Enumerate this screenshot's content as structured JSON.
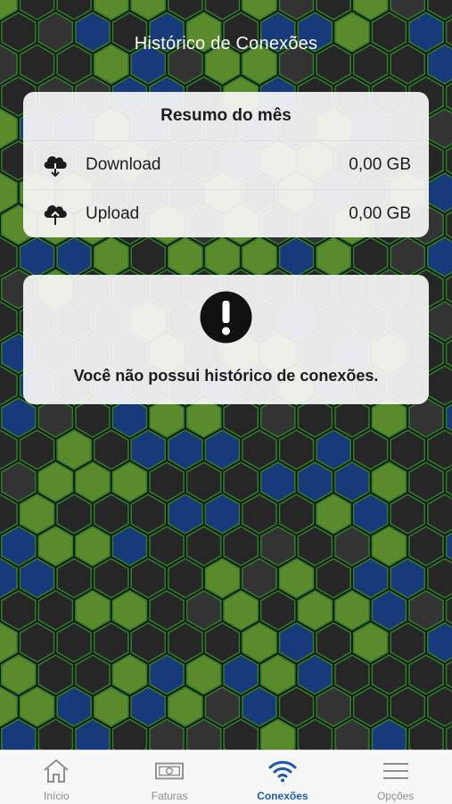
{
  "header": {
    "title": "Histórico de Conexões"
  },
  "summary": {
    "title": "Resumo do mês",
    "rows": [
      {
        "icon": "cloud-download-icon",
        "label": "Download",
        "value": "0,00 GB"
      },
      {
        "icon": "cloud-upload-icon",
        "label": "Upload",
        "value": "0,00 GB"
      }
    ]
  },
  "empty_state": {
    "icon": "exclamation-circle-icon",
    "message": "Você não possui histórico de conexões."
  },
  "colors": {
    "background": "#141414",
    "hex_green": "#5a8a2c",
    "hex_blue": "#163a7a",
    "hex_dark": "#262626",
    "hex_border": "#2f7a2a",
    "tab_active": "#1f5aa8",
    "tab_inactive": "#8e8e8e"
  },
  "tabbar": {
    "tabs": [
      {
        "icon": "house-icon",
        "label": "Início",
        "active": false
      },
      {
        "icon": "banknote-icon",
        "label": "Faturas",
        "active": false
      },
      {
        "icon": "wifi-icon",
        "label": "Conexões",
        "active": true
      },
      {
        "icon": "menu-icon",
        "label": "Opções",
        "active": false
      }
    ]
  }
}
